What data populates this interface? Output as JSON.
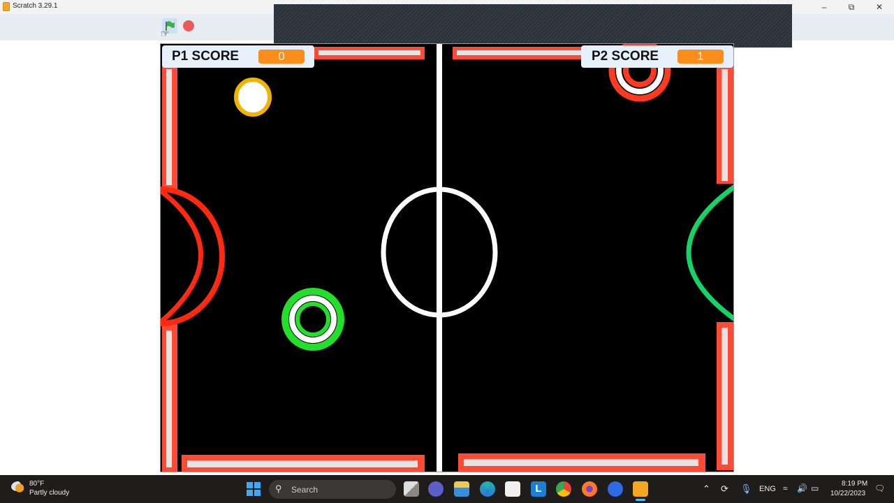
{
  "window": {
    "title": "Scratch 3.29.1",
    "minimize_icon": "minimize-icon",
    "maximize_icon": "restore-icon",
    "close_icon": "close-icon"
  },
  "toolbar": {
    "green_flag_icon": "green-flag-icon",
    "stop_icon": "stop-sign-icon"
  },
  "game": {
    "p1": {
      "label": "P1 SCORE",
      "score": "0"
    },
    "p2": {
      "label": "P2 SCORE",
      "score": "1"
    },
    "colors": {
      "wall": "#ff4a36",
      "wall_inner": "#e8e2e0",
      "p1_goal": "#ff2a10",
      "p2_goal": "#14d468",
      "puck_fill": "#ffffff",
      "puck_ring": "#f0b400",
      "p1_paddle": "#22e02a",
      "p2_paddle": "#ff3a20",
      "center_line": "#ffffff",
      "score_badge": "#fb8d1a"
    }
  },
  "taskbar": {
    "weather_temp": "80°F",
    "weather_desc": "Partly cloudy",
    "search_placeholder": "Search",
    "language": "ENG",
    "time": "8:19 PM",
    "date": "10/22/2023",
    "apps": [
      "start",
      "task-view",
      "teams",
      "file-explorer",
      "edge",
      "store",
      "lexia",
      "chrome",
      "firefox",
      "zoom",
      "scratch"
    ]
  }
}
